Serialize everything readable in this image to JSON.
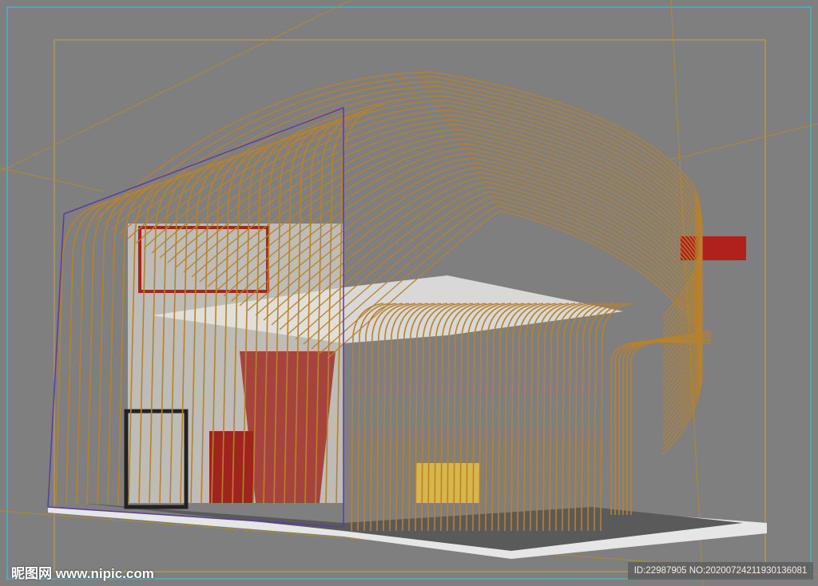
{
  "watermark": {
    "site": "昵图网 www.nipic.com",
    "id_text": "ID:22987905 NO:20200724211930136081"
  },
  "colors": {
    "background": "#7f7f7f",
    "frame": "#3fb8c0",
    "safe_frame": "#c8a040",
    "rods": "#b8822a",
    "accent_red": "#b0201c",
    "floor": "#e6e6e6"
  }
}
